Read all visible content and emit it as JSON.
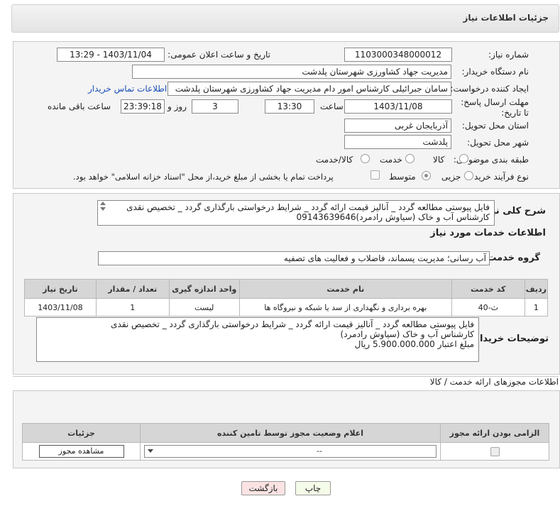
{
  "header": {
    "title": "جزئیات اطلاعات نیاز"
  },
  "form": {
    "need_number_label": "شماره نیاز:",
    "need_number": "1103000348000012",
    "announce_label": "تاریخ و ساعت اعلان عمومی:",
    "announce_value": "1403/11/04 - 13:29",
    "buyer_org_label": "نام دستگاه خریدار:",
    "buyer_org": "مدیریت جهاد کشاورزی شهرستان پلدشت",
    "creator_label": "ایجاد کننده درخواست:",
    "creator": "سامان جبرائیلی کارشناس امور دام  مدیریت جهاد کشاورزی شهرستان پلدشت",
    "contact_link": "اطلاعات تماس خریدار",
    "deadline_label": "مهلت ارسال پاسخ: تا تاریخ:",
    "deadline_date": "1403/11/08",
    "hour_label": "ساعت",
    "deadline_time": "13:30",
    "days_value": "3",
    "days_label": "روز و",
    "remaining_time": "23:39:18",
    "remaining_label": "ساعت باقی مانده",
    "province_label": "استان محل تحویل:",
    "province": "آذربایجان غربی",
    "city_label": "شهر محل تحویل:",
    "city": "پلدشت",
    "category_label": "طبقه بندی موضوعی:",
    "category_options": [
      "کالا",
      "خدمت",
      "کالا/خدمت"
    ],
    "purchase_label": "نوع فرآیند خرید :",
    "purchase_options": [
      "جزیی",
      "متوسط"
    ],
    "payment_note": "پرداخت تمام یا بخشی از مبلغ خرید،از محل \"اسناد خزانه اسلامی\" خواهد بود."
  },
  "summary": {
    "label": "شرح کلی نیاز:",
    "text": "فایل پیوستی مطالعه گردد _ آنالیز قیمت ارائه گردد _ شرایط درخواستی بارگذاری گردد _ تخصیص نقدی\nکارشناس آب و خاک (سیاوش رادمرد)09143639646"
  },
  "services": {
    "title": "اطلاعات خدمات مورد نیاز",
    "group_label": "گروه خدمت:",
    "group_value": "آب رسانی؛ مدیریت پسماند، فاضلاب و فعالیت های تصفیه",
    "columns": [
      "ردیف",
      "کد خدمت",
      "نام خدمت",
      "واحد اندازه گیری",
      "تعداد / مقدار",
      "تاریخ نیاز"
    ],
    "rows": [
      [
        "1",
        "ث-40",
        "بهره برداری و نگهداری از سد یا شبکه و نیروگاه ها",
        "لیست",
        "1",
        "1403/11/08"
      ]
    ]
  },
  "buyer_notes": {
    "label": "توضیحات خریدار:",
    "text": "فایل پیوستی مطالعه گردد _ آنالیز قیمت ارائه گردد _ شرایط درخواستی بارگذاری گردد _ تخصیص نقدی\nکارشناس آب و خاک (سیاوش رادمرد)\nمبلغ اعتبار  5.900.000.000 ریال"
  },
  "permits": {
    "title": "اطلاعات مجوزهای ارائه خدمت / کالا",
    "columns": [
      "الزامی بودن ارائه مجوز",
      "اعلام وضعیت مجوز توسط تامین کننده",
      "جزئیات"
    ],
    "select_value": "--",
    "view_button": "مشاهده مجوز"
  },
  "buttons": {
    "print": "چاپ",
    "back": "بازگشت"
  },
  "colors": {
    "link": "#1a4fb8",
    "back_bg": "#fbe3e3",
    "print_bg": "#f4fbe8"
  }
}
